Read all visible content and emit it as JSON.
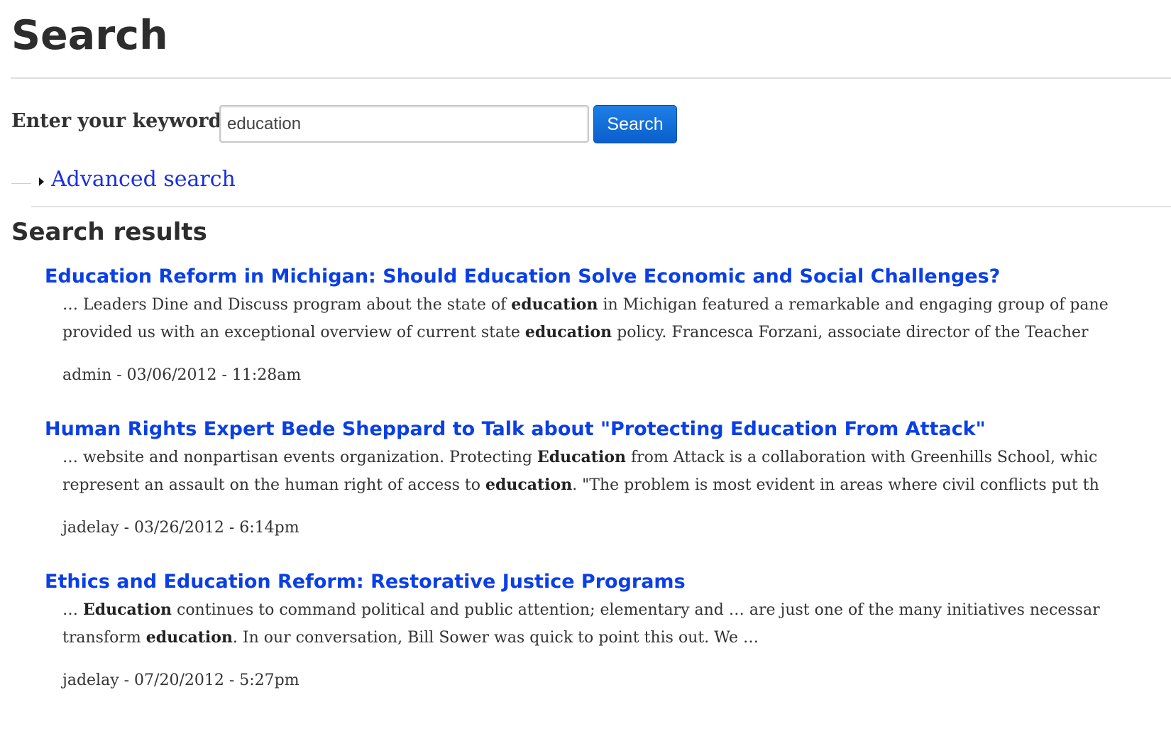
{
  "page": {
    "title": "Search"
  },
  "search_form": {
    "label": "Enter your keywords",
    "input_value": "education",
    "button_label": "Search"
  },
  "advanced": {
    "link_label": "Advanced search"
  },
  "results": {
    "heading": "Search results",
    "items": [
      {
        "title": "Education Reform in Michigan: Should Education Solve Economic and Social Challenges?",
        "snippet_lines": [
          [
            {
              "text": "… Leaders Dine and Discuss program about the state of "
            },
            {
              "text": "education",
              "bold": true
            },
            {
              "text": " in Michigan featured a remarkable and engaging group of pane"
            }
          ],
          [
            {
              "text": "provided us with an exceptional overview of current state "
            },
            {
              "text": "education",
              "bold": true
            },
            {
              "text": " policy. Francesca Forzani, associate director of the Teacher"
            }
          ]
        ],
        "meta": "admin - 03/06/2012 - 11:28am"
      },
      {
        "title": "Human Rights Expert Bede Sheppard to Talk about \"Protecting Education From Attack\"",
        "snippet_lines": [
          [
            {
              "text": "… website and nonpartisan events organization. Protecting "
            },
            {
              "text": "Education",
              "bold": true
            },
            {
              "text": " from Attack is a collaboration with Greenhills School, whic"
            }
          ],
          [
            {
              "text": "represent an assault on the human right of access to "
            },
            {
              "text": "education",
              "bold": true
            },
            {
              "text": ". \"The problem is most evident in areas where civil conflicts put th"
            }
          ]
        ],
        "meta": "jadelay - 03/26/2012 - 6:14pm"
      },
      {
        "title": "Ethics and Education Reform: Restorative Justice Programs",
        "snippet_lines": [
          [
            {
              "text": "… "
            },
            {
              "text": "Education",
              "bold": true
            },
            {
              "text": " continues to command political and public attention; elementary and … are just one of the many initiatives necessar"
            }
          ],
          [
            {
              "text": "transform "
            },
            {
              "text": "education",
              "bold": true
            },
            {
              "text": ". In our conversation, Bill Sower was quick to point this out. We …"
            }
          ]
        ],
        "meta": "jadelay - 07/20/2012 - 5:27pm"
      }
    ]
  },
  "colors": {
    "link": "#0b3fe6",
    "advanced_link": "#1a2fe0",
    "button": "#0a5fcc",
    "text": "#333333",
    "divider": "#dedede"
  }
}
